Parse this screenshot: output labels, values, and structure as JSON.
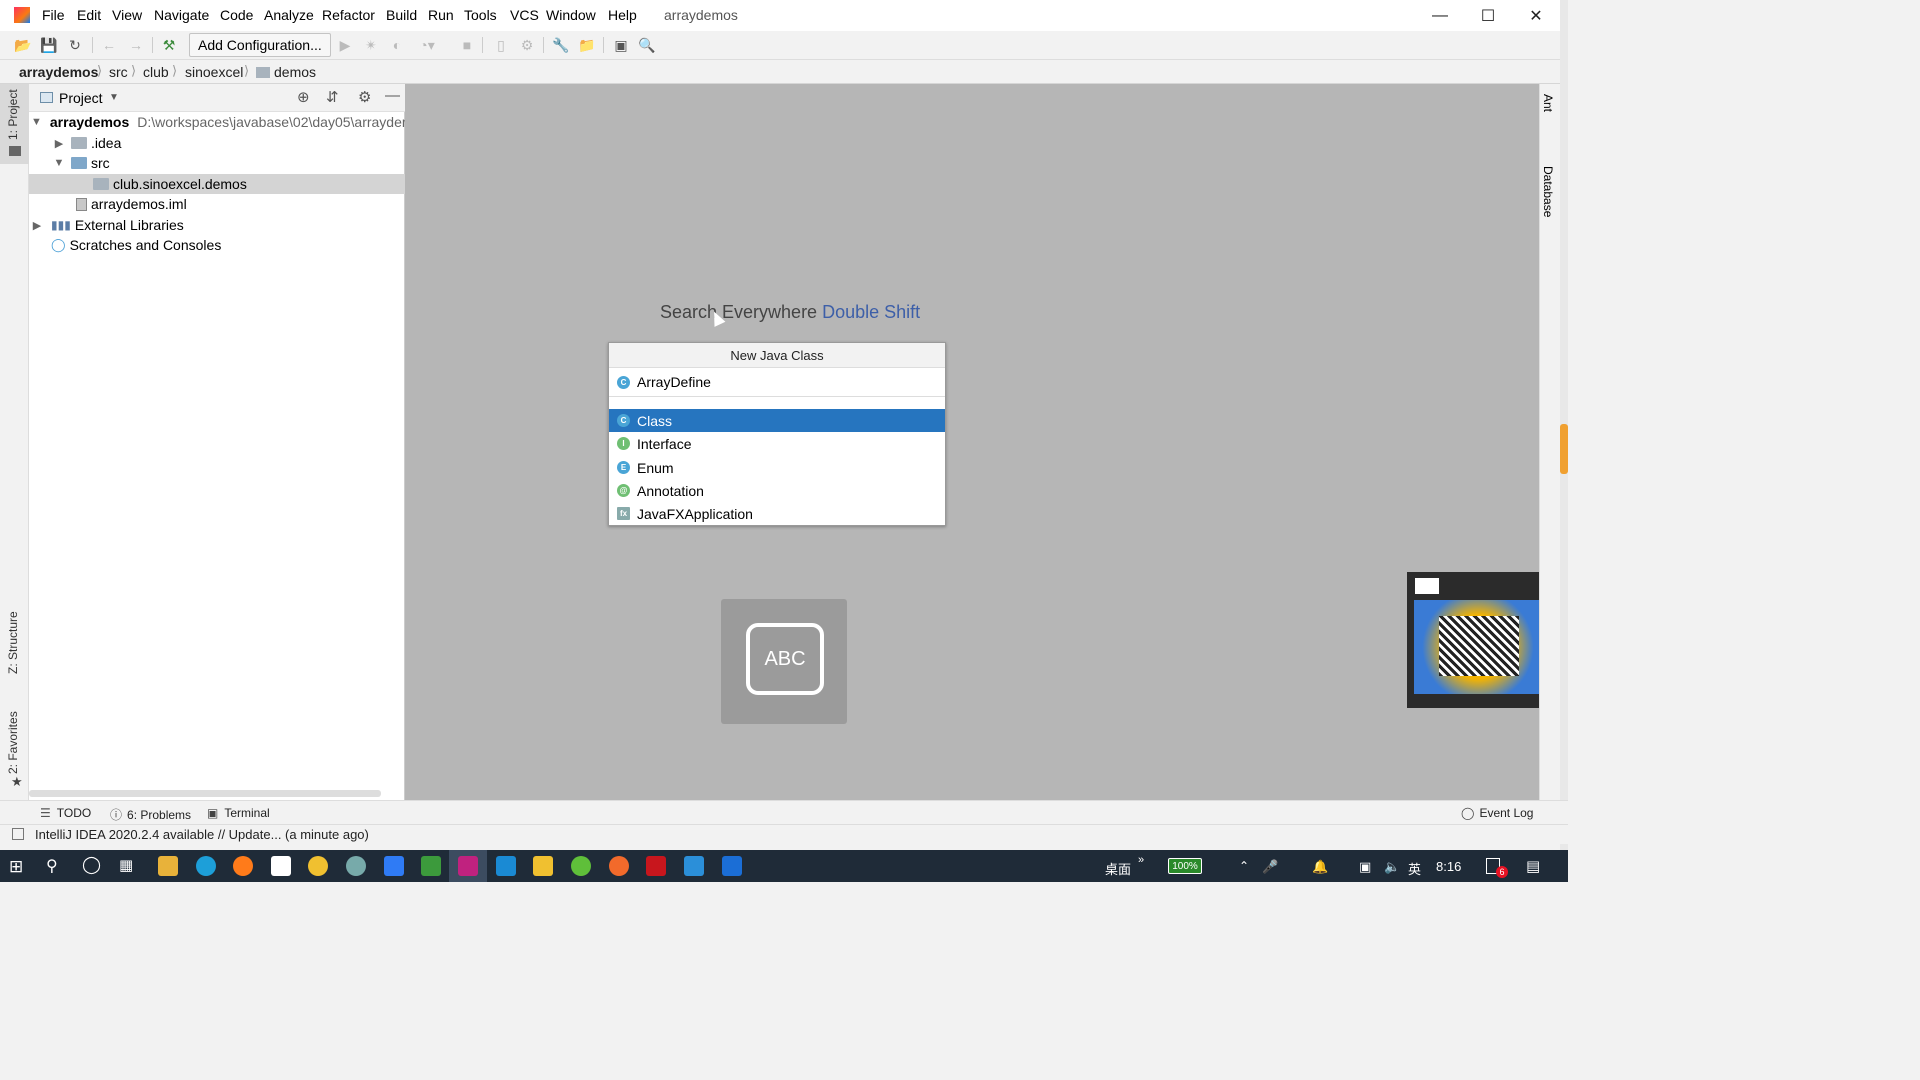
{
  "window": {
    "title": "arraydemos"
  },
  "menu": [
    "File",
    "Edit",
    "View",
    "Navigate",
    "Code",
    "Analyze",
    "Refactor",
    "Build",
    "Run",
    "Tools",
    "VCS",
    "Window",
    "Help"
  ],
  "toolbar": {
    "add_config_label": "Add Configuration..."
  },
  "breadcrumb": [
    "arraydemos",
    "src",
    "club",
    "sinoexcel",
    "demos"
  ],
  "project_panel": {
    "title": "Project",
    "tree": [
      {
        "label": "arraydemos",
        "path": "D:\\workspaces\\javabase\\02\\day05\\arrayder"
      },
      {
        "label": ".idea"
      },
      {
        "label": "src"
      },
      {
        "label": "club.sinoexcel.demos"
      },
      {
        "label": "arraydemos.iml"
      },
      {
        "label": "External Libraries"
      },
      {
        "label": "Scratches and Consoles"
      }
    ]
  },
  "left_tabs": {
    "project": "1: Project",
    "structure": "Z: Structure",
    "favorites": "2: Favorites"
  },
  "right_tabs": {
    "ant": "Ant",
    "database": "Database"
  },
  "editor": {
    "hint_text": "Search Everywhere",
    "hint_key": "Double Shift"
  },
  "popup": {
    "title": "New Java Class",
    "input_value": "ArrayDefine",
    "kinds": [
      {
        "label": "Class",
        "icon": "C",
        "color": "#4aa5d6"
      },
      {
        "label": "Interface",
        "icon": "I",
        "color": "#6fbf73"
      },
      {
        "label": "Enum",
        "icon": "E",
        "color": "#4aa5d6"
      },
      {
        "label": "Annotation",
        "icon": "@",
        "color": "#6fbf73"
      },
      {
        "label": "JavaFXApplication",
        "icon": "fx",
        "color": "#8aa"
      }
    ]
  },
  "ime": {
    "label": "ABC"
  },
  "bottom_tabs": {
    "todo": "TODO",
    "problems": "6: Problems",
    "terminal": "Terminal",
    "event_log": "Event Log"
  },
  "status": {
    "message": "IntelliJ IDEA 2020.2.4 available // Update... (a minute ago)"
  },
  "taskbar": {
    "desktop": "桌面",
    "battery": "100%",
    "lang": "英",
    "time": "8:16",
    "notif_count": "6"
  }
}
